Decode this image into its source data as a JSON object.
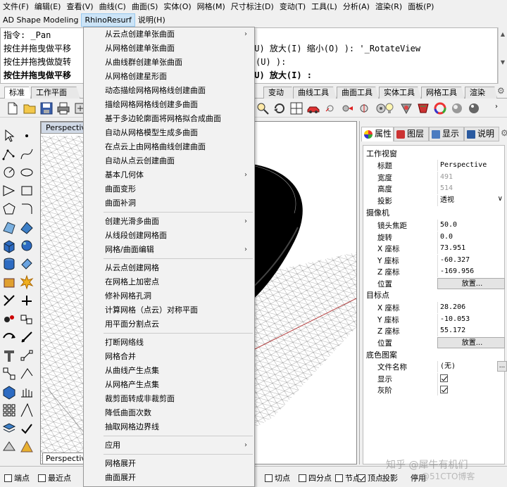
{
  "menubar1": [
    "文件(F)",
    "编辑(E)",
    "查看(V)",
    "曲线(C)",
    "曲面(S)",
    "实体(O)",
    "网格(M)",
    "尺寸标注(D)",
    "变动(T)",
    "工具(L)",
    "分析(A)",
    "渲染(R)",
    "面板(P)"
  ],
  "menubar2": {
    "item1": "AD Shape Modeling",
    "item2": "RhinoResurf",
    "item3": "说明(H)"
  },
  "command": {
    "line1": "指令: _Pan",
    "line2a": "按住并拖曳做平移",
    "line2b": "上(U)  放大(I)  缩小(O) ): '_RotateView",
    "line3a": "按住并拖拽做旋转",
    "line3b": "(U) ):",
    "line4a": "按住并拖曳做平移",
    "line4b": "上(U)  放大(I) :"
  },
  "tabs": [
    "标准",
    "工作平面",
    "变动",
    "曲线工具",
    "曲面工具",
    "实体工具",
    "网格工具",
    "渲染"
  ],
  "viewport": {
    "label": "Perspective",
    "bottom_tab": "Perspective"
  },
  "dropdown": [
    {
      "label": "从云点创建单张曲面",
      "sub": true
    },
    {
      "label": "从网格创建单张曲面",
      "sub": false
    },
    {
      "label": "从曲线群创建单张曲面",
      "sub": false
    },
    {
      "label": "从网格创建星形面",
      "sub": false
    },
    {
      "label": "动态描绘网格网格线创建曲面",
      "sub": false
    },
    {
      "label": "描绘网格网格线创建多曲面",
      "sub": false
    },
    {
      "label": "基于多边轮廓面将网格拟合成曲面",
      "sub": false
    },
    {
      "label": "自动从网格模型生成多曲面",
      "sub": false
    },
    {
      "label": "在点云上由网格曲线创建曲面",
      "sub": false
    },
    {
      "label": "自动从点云创建曲面",
      "sub": false
    },
    {
      "label": "基本几何体",
      "sub": true
    },
    {
      "label": "曲面变形",
      "sub": false
    },
    {
      "label": "曲面补洞",
      "sub": false
    },
    {
      "label": "创建光滑多曲面",
      "sub": true
    },
    {
      "label": "从线段创建网格面",
      "sub": false
    },
    {
      "label": "网格/曲面编辑",
      "sub": true
    },
    {
      "label": "从云点创建网格",
      "sub": false
    },
    {
      "label": "在网格上加密点",
      "sub": false
    },
    {
      "label": "修补网格孔洞",
      "sub": false
    },
    {
      "label": "计算网格（点云）对称平面",
      "sub": false
    },
    {
      "label": "用平面分割点云",
      "sub": false
    },
    {
      "label": "打断网络线",
      "sub": false
    },
    {
      "label": "网格合并",
      "sub": false
    },
    {
      "label": "从曲线产生点集",
      "sub": false
    },
    {
      "label": "从网格产生点集",
      "sub": false
    },
    {
      "label": "裁剪面转成非裁剪面",
      "sub": false
    },
    {
      "label": "降低曲面次数",
      "sub": false
    },
    {
      "label": "抽取网格边界线",
      "sub": false
    },
    {
      "label": "应用",
      "sub": true
    },
    {
      "label": "网格展开",
      "sub": false
    },
    {
      "label": "曲面展开",
      "sub": false
    }
  ],
  "panel": {
    "tabs": [
      "属性",
      "图层",
      "显示",
      "说明"
    ],
    "sections": {
      "viewport": "工作视窗",
      "camera": "摄像机",
      "target": "目标点",
      "wallpaper": "底色图案"
    },
    "viewport_rows": [
      {
        "label": "标题",
        "value": "Perspective"
      },
      {
        "label": "宽度",
        "value": "491"
      },
      {
        "label": "高度",
        "value": "514"
      },
      {
        "label": "投影",
        "value": "透视"
      }
    ],
    "camera_rows": [
      {
        "label": "镜头焦距",
        "value": "50.0"
      },
      {
        "label": "旋转",
        "value": "0.0"
      },
      {
        "label": "X 座标",
        "value": "73.951"
      },
      {
        "label": "Y 座标",
        "value": "-60.327"
      },
      {
        "label": "Z 座标",
        "value": "-169.956"
      },
      {
        "label": "位置",
        "value": "放置..."
      }
    ],
    "target_rows": [
      {
        "label": "X 座标",
        "value": "28.206"
      },
      {
        "label": "Y 座标",
        "value": "-10.053"
      },
      {
        "label": "Z 座标",
        "value": "55.172"
      },
      {
        "label": "位置",
        "value": "放置..."
      }
    ],
    "wallpaper_rows": [
      {
        "label": "文件名称",
        "value": "(无)",
        "btn": "..."
      },
      {
        "label": "显示",
        "checked": true
      },
      {
        "label": "灰阶",
        "checked": true
      }
    ]
  },
  "status": {
    "snaps": [
      {
        "label": "端点",
        "checked": false
      },
      {
        "label": "最近点",
        "checked": false
      },
      {
        "label": "切点",
        "checked": false
      },
      {
        "label": "四分点",
        "checked": false
      },
      {
        "label": "节点",
        "checked": false
      },
      {
        "label": "顶点",
        "checked": true
      },
      {
        "label": "投影",
        "checked": false
      },
      {
        "label": "停用",
        "checked": false
      }
    ]
  },
  "watermark": "知乎 @犀牛有机们",
  "watermark2": "@51CTO博客"
}
